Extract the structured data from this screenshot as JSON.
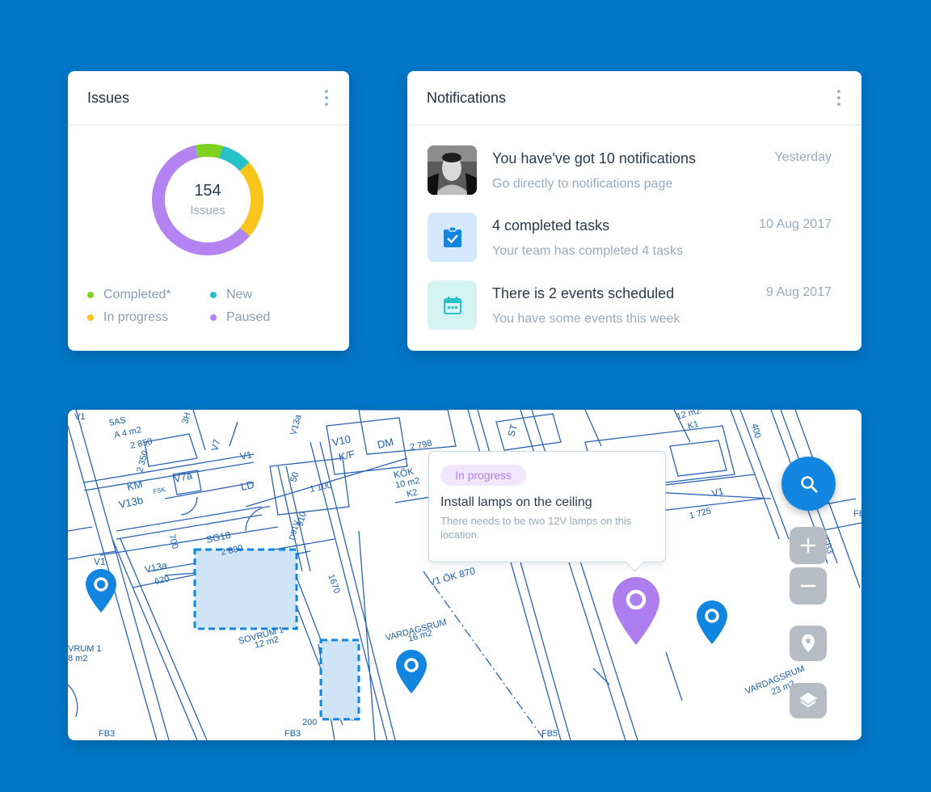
{
  "issues_card": {
    "title": "Issues",
    "total": "154",
    "total_label": "Issues",
    "segments": [
      {
        "name": "Completed*",
        "value": 8,
        "color": "#7ed321"
      },
      {
        "name": "New",
        "value": 9,
        "color": "#26c1c9"
      },
      {
        "name": "In progress",
        "value": 23,
        "color": "#f8c51c"
      },
      {
        "name": "Paused",
        "value": 60,
        "color": "#b383f2"
      }
    ],
    "legend": [
      "Completed*",
      "New",
      "In progress",
      "Paused"
    ]
  },
  "notifications_card": {
    "title": "Notifications",
    "items": [
      {
        "title": "You have've got 10 notifications",
        "subtitle": "Go directly to notifications page",
        "date": "Yesterday",
        "icon": "avatar"
      },
      {
        "title": "4 completed tasks",
        "subtitle": "Your team has completed 4 tasks",
        "date": "10 Aug 2017",
        "icon": "clipboard-check-icon",
        "icon_bg": "#d3e9fb",
        "icon_color": "#1185e0"
      },
      {
        "title": "There is 2 events scheduled",
        "subtitle": "You have some events this week",
        "date": "9 Aug 2017",
        "icon": "calendar-icon",
        "icon_bg": "#d6f3f4",
        "icon_color": "#26c1c9"
      }
    ]
  },
  "map": {
    "popover": {
      "status": "In progress",
      "title": "Install lamps on the ceiling",
      "description": "There needs to be two 12V lamps on this location."
    },
    "plan_labels": [
      "5AS",
      "A 4 m2",
      "2 850",
      "2 350",
      "KM",
      "V13b",
      "V7a",
      "FSK",
      "LD",
      "V7",
      "V1",
      "V10",
      "K/F",
      "DM",
      "2 798",
      "V13a",
      "50",
      "1 100",
      "910",
      "D91V",
      "SG18",
      "2 880",
      "620",
      "V13a",
      "V1",
      "700",
      "KÖK",
      "10 m2",
      "K2",
      "V1 ÖK 870",
      "1670",
      "SOVRUM 1",
      "12 m2",
      "VARDAGSRUM",
      "16 m2",
      "VRUM 1",
      "8 m2",
      "200",
      "FB3",
      "FB3",
      "FB5",
      "ST",
      "12 m2",
      "K1",
      "400",
      "V1",
      "1 725",
      "VARDAGSRUM",
      "23 m2",
      "FB3",
      "V1",
      "FB",
      "3H"
    ],
    "controls": [
      "search-icon",
      "plus-icon",
      "minus-icon",
      "location-icon",
      "layers-icon"
    ]
  }
}
